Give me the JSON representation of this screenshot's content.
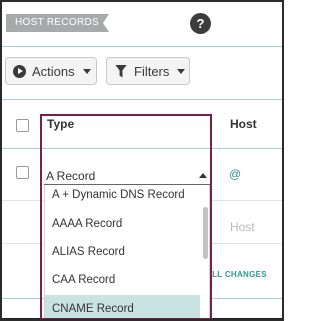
{
  "header": {
    "section_tag": "HOST RECORDS",
    "help_label": "?"
  },
  "toolbar": {
    "actions_label": "Actions",
    "filters_label": "Filters"
  },
  "table": {
    "columns": [
      "Type",
      "Host"
    ],
    "row1": {
      "type_value": "A Record",
      "host_value": "@"
    },
    "row2": {
      "host_placeholder": "Host"
    },
    "save_link_partial": "ALL CHANGES"
  },
  "type_dropdown": {
    "options": [
      "A + Dynamic DNS Record",
      "AAAA Record",
      "ALIAS Record",
      "CAA Record",
      "CNAME Record"
    ],
    "highlighted_option": "CNAME Record"
  },
  "colors": {
    "accent_teal": "#2f9a94",
    "highlight_border": "#7b1f44",
    "selected_option_bg": "#c8e3e1"
  }
}
